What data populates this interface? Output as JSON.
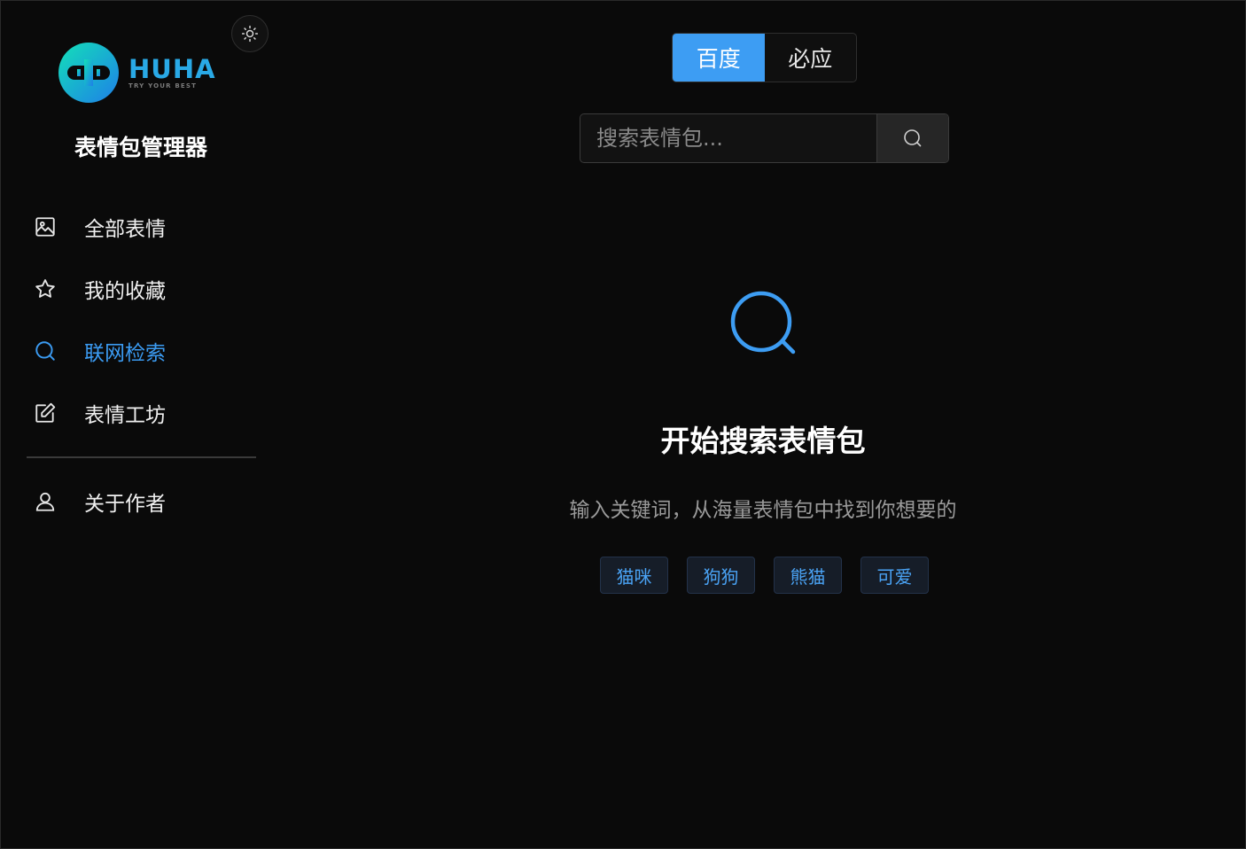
{
  "brand": {
    "logo_title": "HUHA",
    "logo_subtitle": "TRY YOUR BEST",
    "app_title": "表情包管理器",
    "accent_color": "#3d9df3"
  },
  "sidebar": {
    "theme_toggle_icon": "sun-icon",
    "items": [
      {
        "label": "全部表情",
        "icon": "image-icon",
        "active": false
      },
      {
        "label": "我的收藏",
        "icon": "star-icon",
        "active": false
      },
      {
        "label": "联网检索",
        "icon": "search-icon",
        "active": true
      },
      {
        "label": "表情工坊",
        "icon": "edit-icon",
        "active": false
      }
    ],
    "footer_items": [
      {
        "label": "关于作者",
        "icon": "user-icon",
        "active": false
      }
    ]
  },
  "engines": {
    "options": [
      "百度",
      "必应"
    ],
    "selected": "百度"
  },
  "search": {
    "placeholder": "搜索表情包...",
    "value": ""
  },
  "empty_state": {
    "icon": "search-icon",
    "title": "开始搜索表情包",
    "subtitle": "输入关键词，从海量表情包中找到你想要的",
    "suggestions": [
      "猫咪",
      "狗狗",
      "熊猫",
      "可爱"
    ]
  }
}
